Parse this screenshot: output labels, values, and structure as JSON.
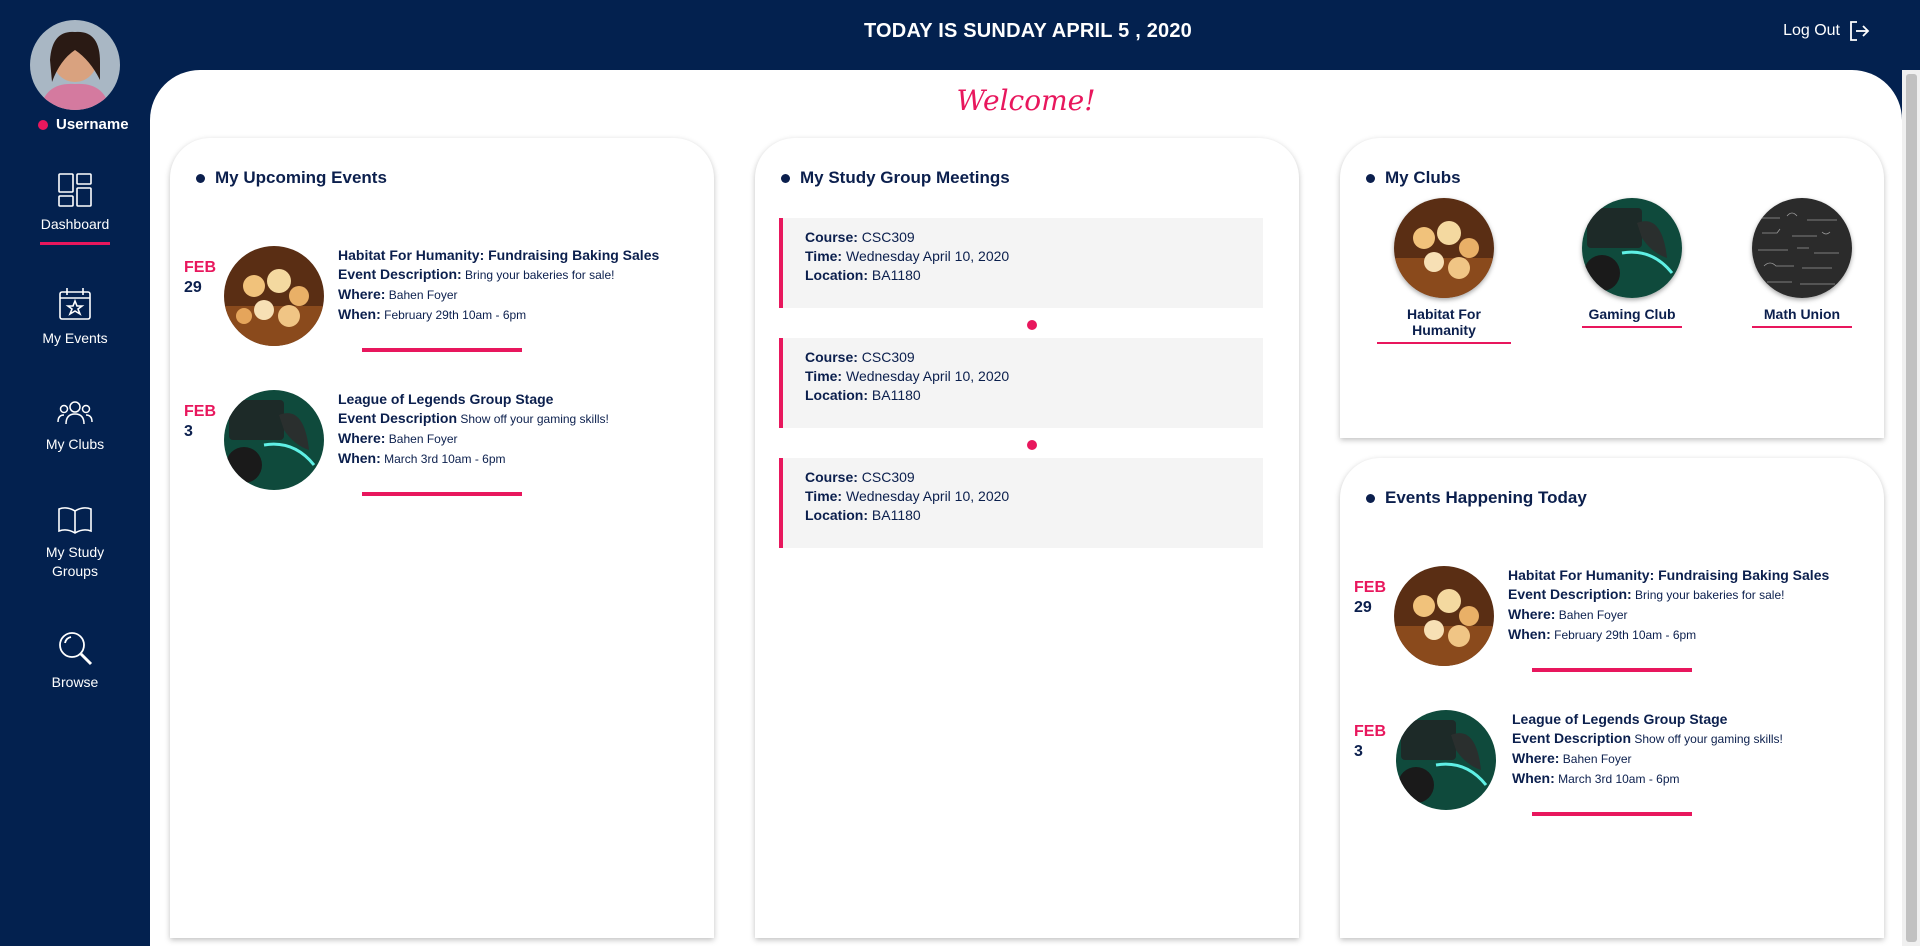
{
  "header": {
    "title": "TODAY IS SUNDAY APRIL 5 , 2020",
    "logout_label": "Log Out"
  },
  "user": {
    "username": "Username"
  },
  "sidebar": {
    "items": [
      {
        "label": "Dashboard",
        "icon": "dashboard-icon"
      },
      {
        "label": "My Events",
        "icon": "calendar-star-icon"
      },
      {
        "label": "My Clubs",
        "icon": "group-icon"
      },
      {
        "label": "My Study Groups",
        "icon": "book-icon"
      },
      {
        "label": "Browse",
        "icon": "search-icon"
      }
    ]
  },
  "main": {
    "welcome": "Welcome!"
  },
  "upcoming": {
    "title": "My Upcoming Events",
    "events": [
      {
        "month": "FEB",
        "day": "29",
        "name": "Habitat For Humanity: Fundraising Baking Sales",
        "desc_label": "Event Description:",
        "desc": "Bring your bakeries for sale!",
        "where_label": "Where:",
        "where": "Bahen Foyer",
        "when_label": "When:",
        "when": "February 29th 10am - 6pm"
      },
      {
        "month": "FEB",
        "day": "3",
        "name": "League of Legends Group Stage",
        "desc_label": "Event Description",
        "desc": "Show off your gaming skills!",
        "where_label": "Where:",
        "where": "Bahen Foyer",
        "when_label": "When:",
        "when": "March 3rd 10am - 6pm"
      }
    ]
  },
  "study": {
    "title": "My Study Group Meetings",
    "meetings": [
      {
        "course_label": "Course:",
        "course": "CSC309",
        "time_label": "Time:",
        "time": "Wednesday April 10, 2020",
        "location_label": "Location:",
        "location": "BA1180"
      },
      {
        "course_label": "Course:",
        "course": "CSC309",
        "time_label": "Time:",
        "time": "Wednesday April 10, 2020",
        "location_label": "Location:",
        "location": "BA1180"
      },
      {
        "course_label": "Course:",
        "course": "CSC309",
        "time_label": "Time:",
        "time": "Wednesday April 10, 2020",
        "location_label": "Location:",
        "location": "BA1180"
      }
    ]
  },
  "clubs": {
    "title": "My Clubs",
    "items": [
      {
        "name": "Habitat For Humanity"
      },
      {
        "name": "Gaming Club"
      },
      {
        "name": "Math Union"
      }
    ]
  },
  "today": {
    "title": "Events Happening Today",
    "events": [
      {
        "month": "FEB",
        "day": "29",
        "name": "Habitat For Humanity: Fundraising Baking Sales",
        "desc_label": "Event Description:",
        "desc": "Bring your bakeries for sale!",
        "where_label": "Where:",
        "where": "Bahen Foyer",
        "when_label": "When:",
        "when": "February 29th 10am - 6pm"
      },
      {
        "month": "FEB",
        "day": "3",
        "name": "League of Legends Group Stage",
        "desc_label": "Event Description",
        "desc": "Show off your gaming skills!",
        "where_label": "Where:",
        "where": "Bahen Foyer",
        "when_label": "When:",
        "when": "March 3rd 10am - 6pm"
      }
    ]
  },
  "colors": {
    "navy": "#03214f",
    "accent": "#e8175d",
    "text": "#0b1f4d"
  }
}
